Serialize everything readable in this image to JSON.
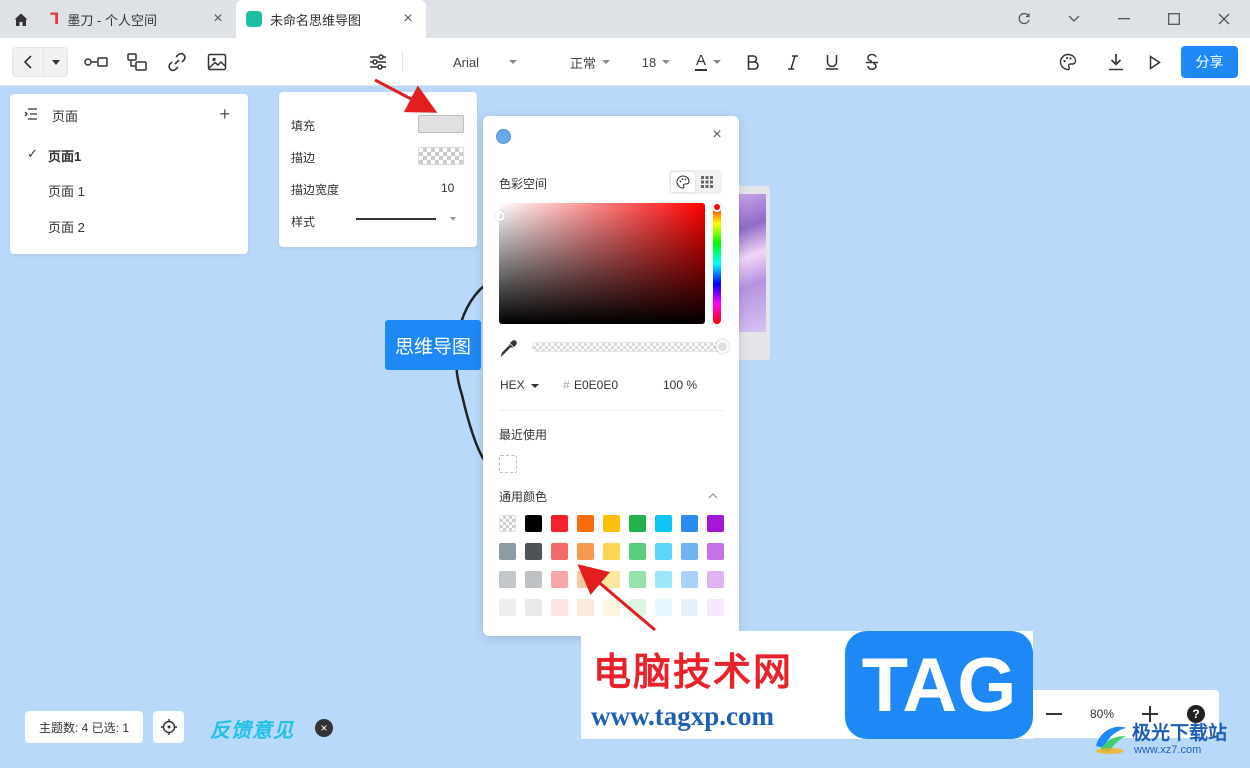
{
  "tabs": [
    {
      "title": "墨刀 - 个人空间"
    },
    {
      "title": "未命名思维导图"
    }
  ],
  "toolbar": {
    "font_family": "Arial",
    "font_weight": "正常",
    "font_size": "18",
    "text_color_label": "A",
    "share_label": "分享"
  },
  "pages_panel": {
    "title": "页面",
    "items": [
      {
        "label": "页面1",
        "active": true
      },
      {
        "label": "页面 1",
        "active": false
      },
      {
        "label": "页面 2",
        "active": false
      }
    ]
  },
  "style_panel": {
    "fill_label": "填充",
    "fill_color": "#E0E0E0",
    "stroke_label": "描边",
    "stroke_width_label": "描边宽度",
    "stroke_width_value": "10",
    "style_label": "样式"
  },
  "canvas": {
    "node_text": "思维导图"
  },
  "color_picker": {
    "color_space_label": "色彩空间",
    "hex_mode": "HEX",
    "hex_value": "E0E0E0",
    "alpha": "100 %",
    "recent_label": "最近使用",
    "common_label": "通用颜色",
    "current_hue": "#ff0000",
    "swatches": [
      [
        "transparent",
        "#000000",
        "#f5222d",
        "#fa6e0a",
        "#fac00a",
        "#23b14d",
        "#10c5f5",
        "#2b8cef",
        "#a318d6"
      ],
      [
        "#8c9ba4",
        "#4d5256",
        "#f46a6a",
        "#fa9a52",
        "#fcd653",
        "#5bce7c",
        "#5bd6f7",
        "#6fb3f5",
        "#c574e6"
      ],
      [
        "#c2c7cc",
        "#bfc2c5",
        "#f7a7a7",
        "#fbc7a2",
        "#fde6a0",
        "#97e2ac",
        "#a0e6fa",
        "#a9d1f8",
        "#dfb3f1"
      ],
      [
        "#eceeef",
        "#e8e9ea",
        "#fde3e3",
        "#fde9dc",
        "#fef6dc",
        "#ddf6e4",
        "#e3f7fd",
        "#e7f1fd",
        "#f5e6fb"
      ]
    ]
  },
  "status": {
    "summary": "主题数: 4 已选: 1",
    "feedback": "反馈意见"
  },
  "zoom": {
    "value": "80%"
  },
  "watermark": {
    "cn": "电脑技术网",
    "url": "www.tagxp.com",
    "tag": "TAG",
    "site_cn": "极光下载站",
    "site_url": "www.xz7.com"
  }
}
